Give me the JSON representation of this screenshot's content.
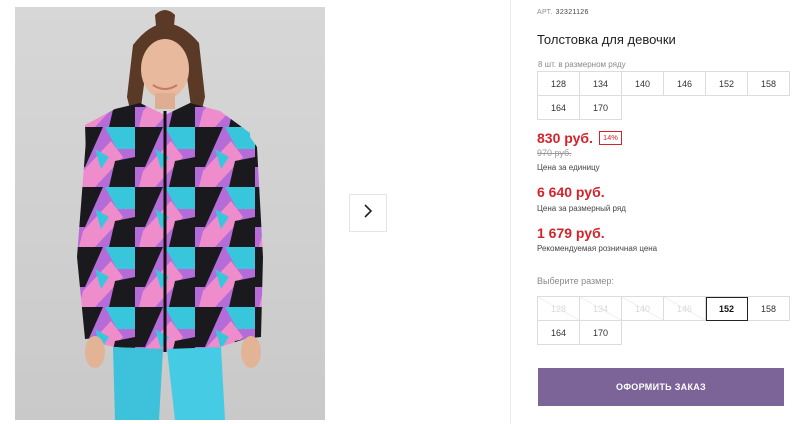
{
  "gallery": {
    "next_icon": "chevron-right-icon"
  },
  "product": {
    "article_label": "АРТ.",
    "article_number": "32321126",
    "title": "Толстовка для девочки",
    "pack_label": "8 шт. в размерном ряду",
    "pack_sizes": [
      "128",
      "134",
      "140",
      "146",
      "152",
      "158",
      "164",
      "170"
    ]
  },
  "pricing": {
    "unit_price": "830 руб.",
    "discount_badge": "14%",
    "old_price": "970 руб.",
    "unit_caption": "Цена за единицу",
    "pack_price": "6 640 руб.",
    "pack_caption": "Цена за размерный ряд",
    "retail_price": "1 679 руб.",
    "retail_caption": "Рекомендуемая розничная цена"
  },
  "size_picker": {
    "label": "Выберите размер:",
    "sizes": [
      {
        "label": "128",
        "state": "disabled"
      },
      {
        "label": "134",
        "state": "disabled"
      },
      {
        "label": "140",
        "state": "disabled"
      },
      {
        "label": "146",
        "state": "disabled"
      },
      {
        "label": "152",
        "state": "selected"
      },
      {
        "label": "158",
        "state": "available"
      },
      {
        "label": "164",
        "state": "available"
      },
      {
        "label": "170",
        "state": "available"
      }
    ]
  },
  "actions": {
    "order_label": "ОФОРМИТЬ ЗАКАЗ"
  },
  "colors": {
    "price_red": "#d3242b",
    "button_purple": "#7c6499"
  }
}
